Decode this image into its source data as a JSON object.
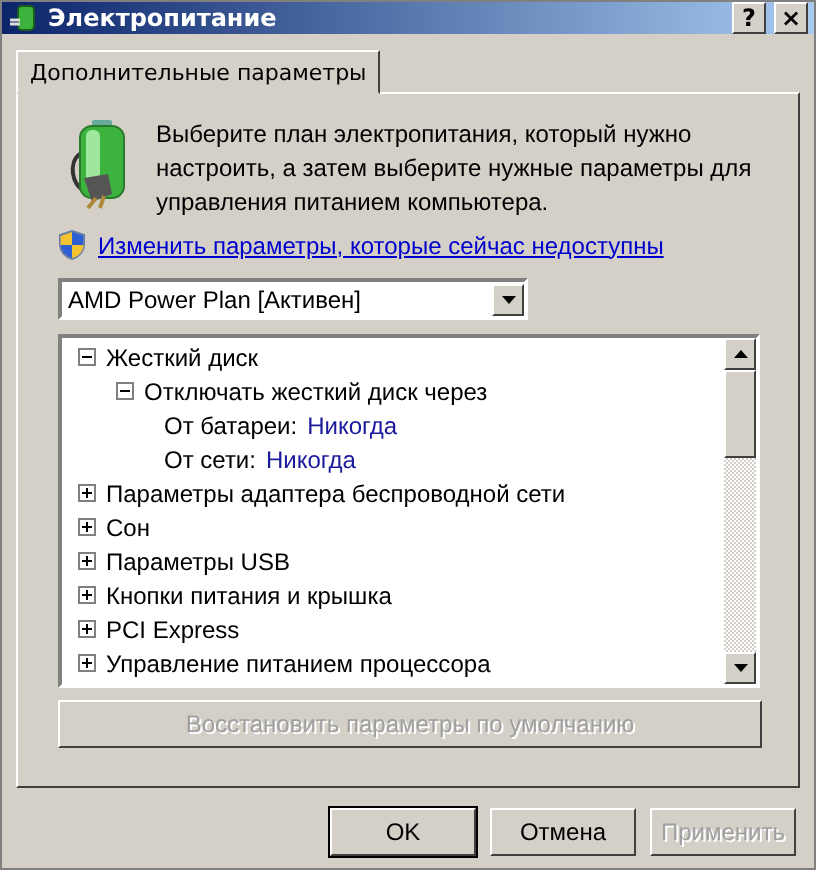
{
  "window": {
    "title": "Электропитание",
    "help_button": "?",
    "close_button": "×"
  },
  "tabs": [
    {
      "label": "Дополнительные параметры",
      "selected": true
    }
  ],
  "intro": {
    "text": "Выберите план электропитания, который нужно настроить, а затем выберите нужные параметры для управления питанием компьютера.",
    "link": "Изменить параметры, которые сейчас недоступны"
  },
  "plan_select": {
    "value": "AMD Power Plan [Активен]"
  },
  "tree": [
    {
      "kind": "group",
      "label": "Жесткий диск",
      "expanded": true,
      "children": [
        {
          "kind": "group",
          "label": "Отключать жесткий диск через",
          "expanded": true,
          "children": [
            {
              "kind": "setting",
              "label": "От батареи:",
              "value": "Никогда"
            },
            {
              "kind": "setting",
              "label": "От сети:",
              "value": "Никогда"
            }
          ]
        }
      ]
    },
    {
      "kind": "group",
      "label": "Параметры адаптера беспроводной сети",
      "expanded": false
    },
    {
      "kind": "group",
      "label": "Сон",
      "expanded": false
    },
    {
      "kind": "group",
      "label": "Параметры USB",
      "expanded": false
    },
    {
      "kind": "group",
      "label": "Кнопки питания и крышка",
      "expanded": false
    },
    {
      "kind": "group",
      "label": "PCI Express",
      "expanded": false
    },
    {
      "kind": "group",
      "label": "Управление питанием процессора",
      "expanded": false
    }
  ],
  "restore_button": {
    "label": "Восстановить параметры по умолчанию",
    "disabled": true
  },
  "buttons": [
    {
      "label": "OK",
      "disabled": false,
      "default": true
    },
    {
      "label": "Отмена",
      "disabled": false,
      "default": false
    },
    {
      "label": "Применить",
      "disabled": true,
      "default": false
    }
  ]
}
